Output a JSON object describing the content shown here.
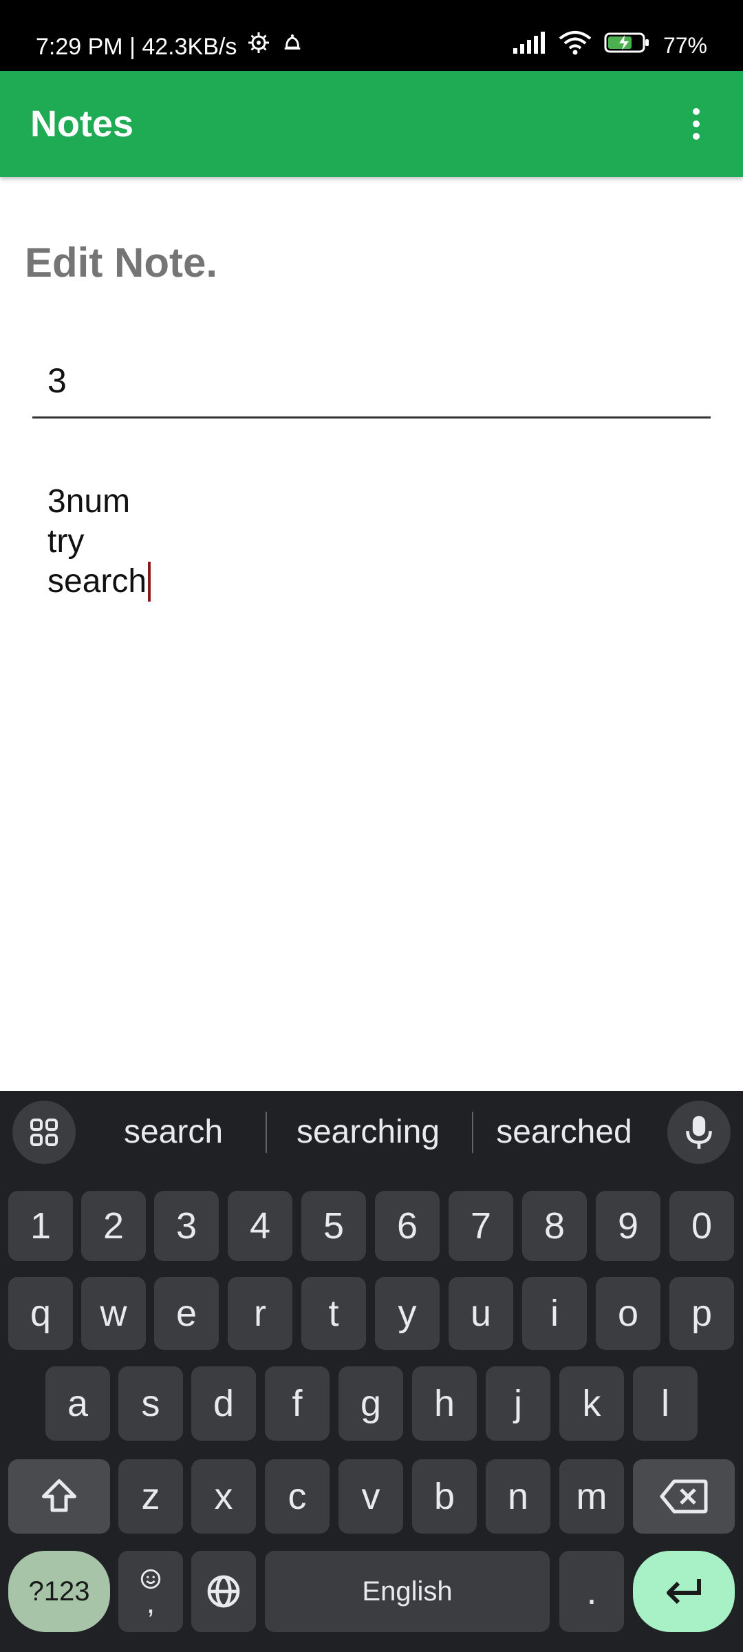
{
  "status_bar": {
    "time_speed": "7:29 PM | 42.3KB/s",
    "battery": "77%"
  },
  "app_bar": {
    "title": "Notes",
    "overflow_icon": "more-vert-icon"
  },
  "content": {
    "heading": "Edit Note.",
    "title_value": "3",
    "body_lines": [
      "3num",
      "try",
      "search"
    ]
  },
  "keyboard": {
    "suggestions": [
      "search",
      "searching",
      "searched"
    ],
    "row_numbers": [
      "1",
      "2",
      "3",
      "4",
      "5",
      "6",
      "7",
      "8",
      "9",
      "0"
    ],
    "row_1": [
      "q",
      "w",
      "e",
      "r",
      "t",
      "y",
      "u",
      "i",
      "o",
      "p"
    ],
    "row_2": [
      "a",
      "s",
      "d",
      "f",
      "g",
      "h",
      "j",
      "k",
      "l"
    ],
    "row_3": [
      "z",
      "x",
      "c",
      "v",
      "b",
      "n",
      "m"
    ],
    "symbols_label": "?123",
    "comma_label": ",",
    "space_label": "English",
    "period_label": "."
  },
  "colors": {
    "app_bar": "#1faa54",
    "keyboard_bg": "#202124",
    "key_bg": "#3c3d40",
    "enter_key": "#a8f0c6"
  }
}
